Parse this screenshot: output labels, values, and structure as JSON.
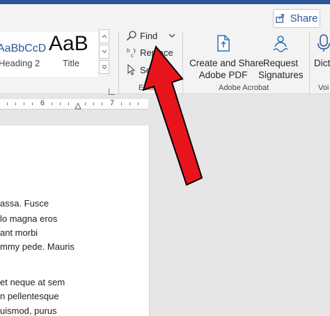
{
  "share": {
    "label": "Share"
  },
  "styles": {
    "preview_1": "AaBbCcD",
    "preview_2": "AaB",
    "name_1": "Heading 2",
    "name_2": "Title"
  },
  "editing": {
    "find": "Find",
    "replace": "Replace",
    "select": "Select",
    "group_label": "Editing"
  },
  "acrobat": {
    "create_line1": "Create and Share",
    "create_line2": "Adobe PDF",
    "request_line1": "Request",
    "request_line2": "Signatures",
    "group_label": "Adobe Acrobat"
  },
  "partial": {
    "dictate": "Dict",
    "voice_group": "Voi"
  },
  "ruler": {
    "six": "6",
    "seven": "7"
  },
  "document": {
    "lines": [
      "assa. Fusce",
      "lo magna eros",
      "ant morbi",
      "mmy pede. Mauris",
      "et neque at sem",
      "n pellentesque",
      "uismod, purus"
    ]
  },
  "colors": {
    "accent": "#2b579a",
    "arrow": "#e8141c",
    "acrobat_icon": "#2b6fb6"
  }
}
